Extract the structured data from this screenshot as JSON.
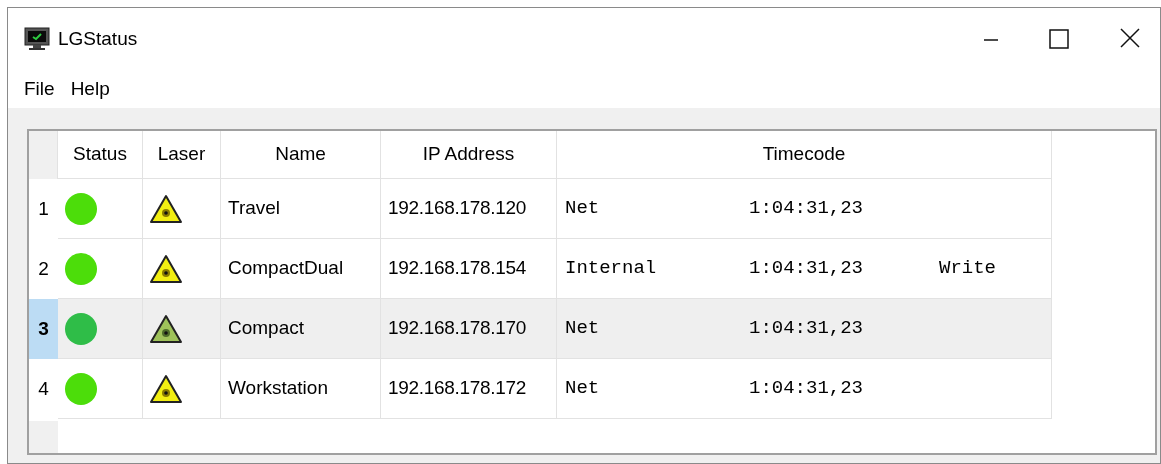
{
  "window": {
    "title": "LGStatus"
  },
  "menu": [
    "File",
    "Help"
  ],
  "table": {
    "columns": [
      "Status",
      "Laser",
      "Name",
      "IP Address",
      "Timecode"
    ],
    "rows": [
      {
        "number": "1",
        "selected": false,
        "name": "Travel",
        "ip": "192.168.178.120",
        "source": "Net",
        "timecode": "1:04:31,23"
      },
      {
        "number": "2",
        "selected": false,
        "name": "CompactDual",
        "ip": "192.168.178.154",
        "source": "Internal",
        "timecode": "1:04:31,23",
        "mode": "Write"
      },
      {
        "number": "3",
        "selected": true,
        "name": "Compact",
        "ip": "192.168.178.170",
        "source": "Net",
        "timecode": "1:04:31,23"
      },
      {
        "number": "4",
        "selected": false,
        "name": "Workstation",
        "ip": "192.168.178.172",
        "source": "Net",
        "timecode": "1:04:31,23"
      }
    ]
  }
}
